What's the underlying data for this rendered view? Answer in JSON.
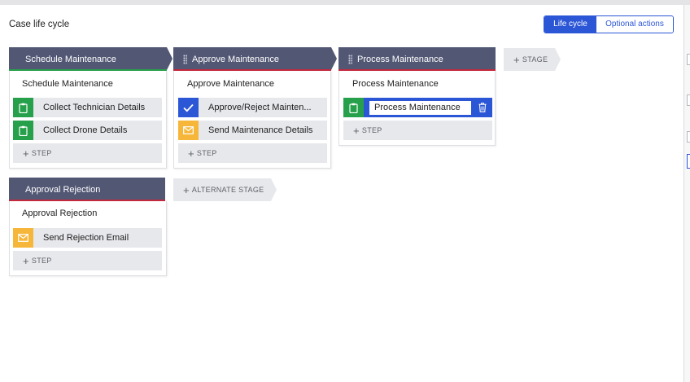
{
  "page": {
    "title": "Case life cycle"
  },
  "view_toggle": {
    "lifecycle_label": "Life cycle",
    "optional_label": "Optional actions"
  },
  "colors": {
    "header": "#525774",
    "accent_blue": "#2b56d6",
    "green": "#26a04a",
    "red_line": "#c5283d",
    "yellow": "#f6b63a",
    "step_bg": "#e7e8ec"
  },
  "stages": [
    {
      "name": "Schedule Maintenance",
      "process": "Schedule Maintenance",
      "line_color": "#26a04a",
      "steps": [
        {
          "label": "Collect Technician Details",
          "icon": "clipboard-icon"
        },
        {
          "label": "Collect Drone Details",
          "icon": "clipboard-icon"
        }
      ],
      "add_step": "STEP"
    },
    {
      "name": "Approve Maintenance",
      "process": "Approve Maintenance",
      "line_color": "#c5283d",
      "steps": [
        {
          "label": "Approve/Reject Mainten...",
          "icon": "checkmark-icon"
        },
        {
          "label": "Send Maintenance Details",
          "icon": "envelope-icon"
        }
      ],
      "add_step": "STEP"
    },
    {
      "name": "Process Maintenance",
      "process": "Process Maintenance",
      "line_color": "#c5283d",
      "steps": [
        {
          "label": "Process Maintenance",
          "icon": "clipboard-icon",
          "editing": true
        }
      ],
      "add_step": "STEP"
    }
  ],
  "add_stage": "STAGE",
  "alternate_stages": [
    {
      "name": "Approval Rejection",
      "process": "Approval Rejection",
      "line_color": "#c5283d",
      "steps": [
        {
          "label": "Send Rejection Email",
          "icon": "envelope-icon"
        }
      ],
      "add_step": "STEP"
    }
  ],
  "add_alternate_stage": "ALTERNATE STAGE"
}
